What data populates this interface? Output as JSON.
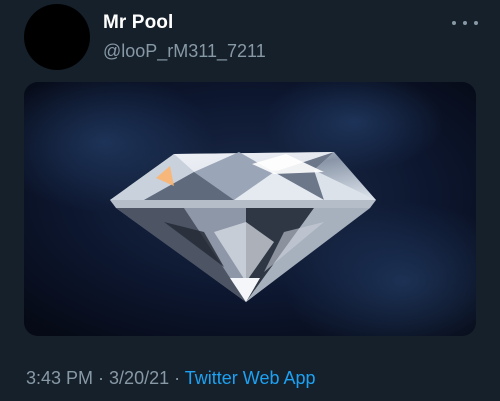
{
  "tweet": {
    "display_name": "Mr Pool",
    "handle": "@looP_rM311_7211",
    "time": "3:43 PM",
    "date": "3/20/21",
    "separator": " · ",
    "source": "Twitter Web App"
  },
  "media": {
    "subject": "diamond"
  },
  "icons": {
    "more": "more-horizontal-icon"
  },
  "colors": {
    "background": "#15202b",
    "secondary_text": "#8899a6",
    "link": "#1da1f2"
  }
}
